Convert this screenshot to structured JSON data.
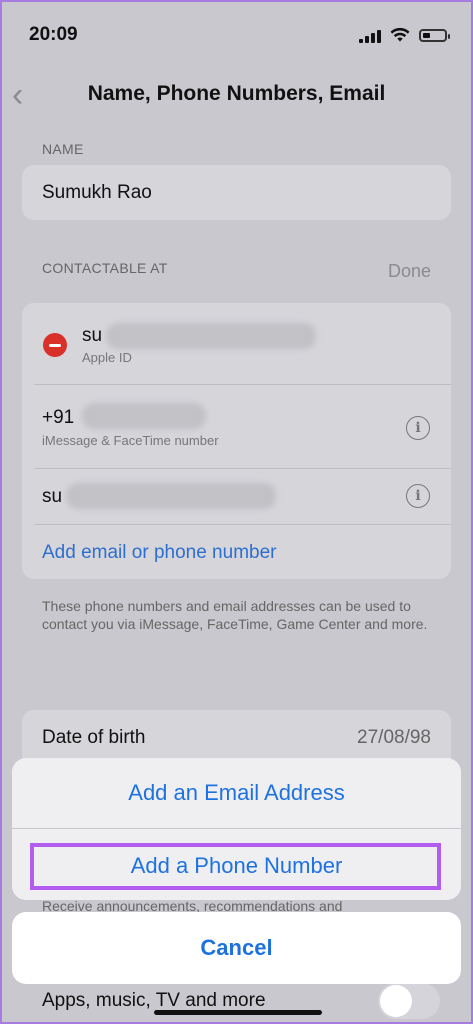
{
  "status": {
    "time": "20:09"
  },
  "nav": {
    "title": "Name, Phone Numbers, Email"
  },
  "name_section": {
    "label": "NAME",
    "value": "Sumukh Rao"
  },
  "contact_section": {
    "label": "CONTACTABLE AT",
    "done": "Done",
    "rows": [
      {
        "prefix": "su",
        "sub": "Apple ID"
      },
      {
        "prefix": "+91",
        "sub": "iMessage & FaceTime number"
      },
      {
        "prefix": "su"
      }
    ],
    "add_link": "Add email or phone number",
    "footnote": "These phone numbers and email addresses can be used to contact you via iMessage, FaceTime, Game Center and more."
  },
  "dob": {
    "label": "Date of birth",
    "value": "27/08/98"
  },
  "behind_text": "Receive announcements, recommendations and",
  "apps_row": {
    "label": "Apps, music, TV and more"
  },
  "action_sheet": {
    "add_email": "Add an Email Address",
    "add_phone": "Add a Phone Number",
    "cancel": "Cancel"
  },
  "colors": {
    "accent": "#1e72e0",
    "highlight": "#b25cf0",
    "destructive": "#d9302a"
  }
}
